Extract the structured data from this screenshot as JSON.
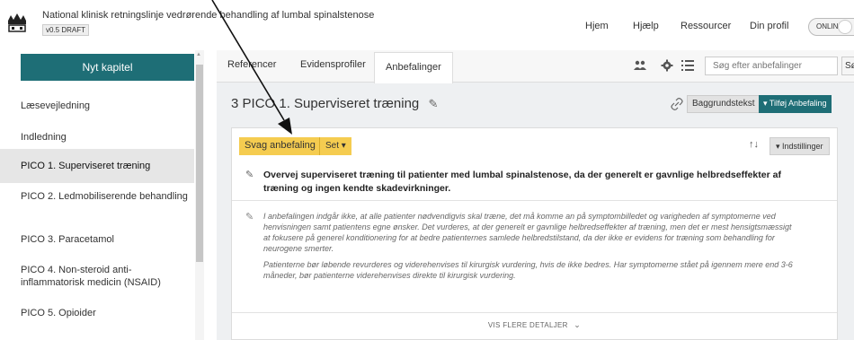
{
  "app": {
    "doc_title": "National klinisk retningslinje vedrørende behandling af lumbal spinalstenose",
    "version": "v0.5 DRAFT",
    "nav": [
      "Hjem",
      "Hjælp",
      "Ressourcer",
      "Din profil"
    ],
    "status_toggle": "ONLINE"
  },
  "sidebar": {
    "new_chapter": "Nyt kapitel",
    "items": [
      "Læsevejledning",
      "Indledning",
      "PICO 1. Superviseret træning",
      "PICO 2. Ledmobiliserende behandling",
      "PICO 3. Paracetamol",
      "PICO 4. Non-steroid anti-inflammatorisk medicin (NSAID)",
      "PICO 5. Opioider"
    ],
    "active_index": 2
  },
  "tabs": [
    "Referencer",
    "Evidensprofiler",
    "Anbefalinger"
  ],
  "active_tab": 2,
  "search": {
    "placeholder": "Søg efter anbefalinger",
    "button": "Søg"
  },
  "section": {
    "number": "3",
    "title": "PICO 1. Superviseret træning",
    "background_button": "Baggrundstekst",
    "add_button": "▾ Tilføj Anbefaling"
  },
  "recommendation": {
    "strength": "Svag anbefaling",
    "set_button": "Set ▾",
    "settings_button": "▾ Indstillinger",
    "text": "Overvej superviseret træning til patienter med lumbal spinalstenose, da der generelt er gavnlige helbredseffekter af træning og ingen kendte skadevirkninger.",
    "note_p1": "I anbefalingen indgår ikke, at alle patienter nødvendigvis skal træne, det må komme an på symptombilledet og varigheden af symptomerne ved henvisningen samt patientens egne ønsker. Det vurderes, at der generelt er gavnlige helbredseffekter af træning, men det er mest hensigtsmæssigt at fokusere på generel konditionering for at bedre patienternes samlede helbredstilstand, da der ikke er evidens for træning som behandling for neurogene smerter.",
    "note_p2": "Patienterne bør løbende revurderes og viderehenvises til kirurgisk vurdering, hvis de ikke bedres. Har symptomerne stået på igennem mere end 3-6 måneder, bør patienterne viderehenvises direkte til kirurgisk vurdering.",
    "more_details": "VIS FLERE DETALJER"
  },
  "colors": {
    "accent": "#1e6e76",
    "badge": "#f5cc50"
  }
}
